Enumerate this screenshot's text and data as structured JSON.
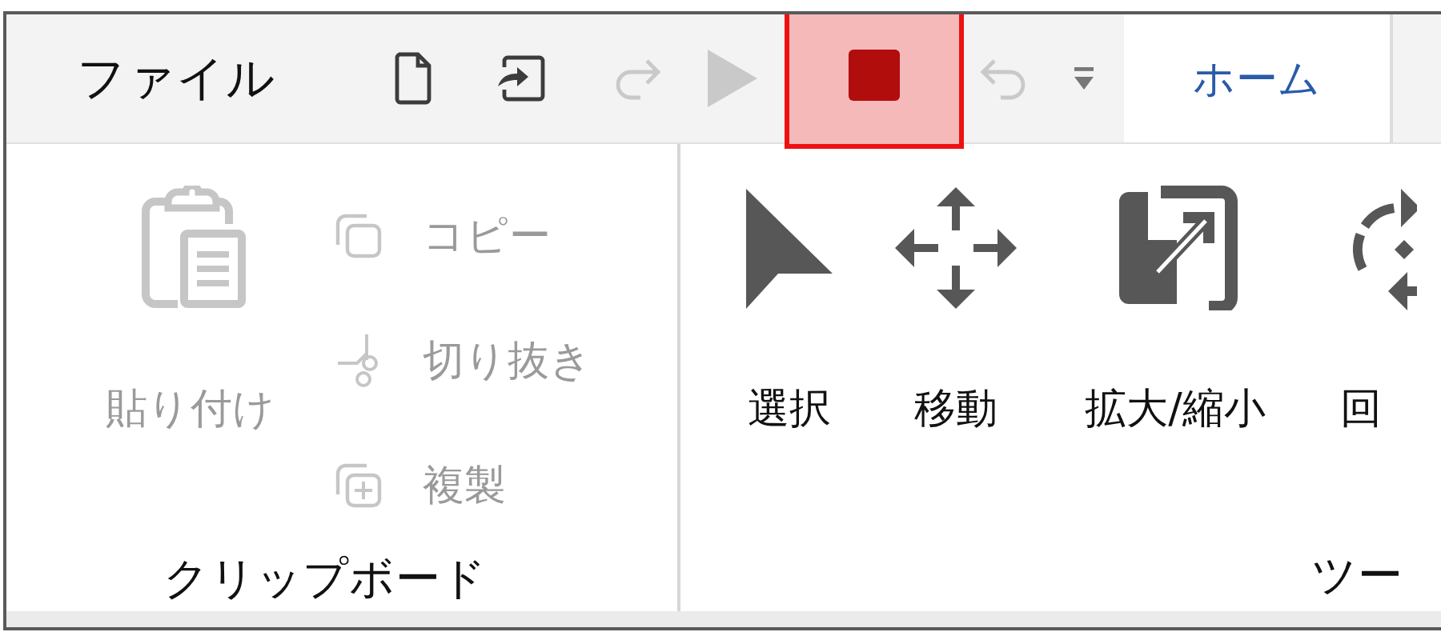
{
  "menu": {
    "label": "ファイル"
  },
  "quick_access": [
    {
      "kind": "new-file",
      "disabled": false,
      "highlighted": false
    },
    {
      "kind": "import",
      "disabled": false,
      "highlighted": false
    },
    {
      "kind": "redo",
      "disabled": true,
      "highlighted": false
    },
    {
      "kind": "play",
      "disabled": true,
      "highlighted": false
    },
    {
      "kind": "stop",
      "disabled": false,
      "highlighted": true
    },
    {
      "kind": "undo",
      "disabled": true,
      "highlighted": false
    },
    {
      "kind": "customize",
      "disabled": false,
      "highlighted": false
    }
  ],
  "tabs": [
    {
      "label": "ホーム",
      "selected": true
    }
  ],
  "groups": [
    {
      "title": "クリップボード",
      "large_items": [
        {
          "label": "貼り付け",
          "kind": "paste",
          "disabled": true
        }
      ],
      "small_items": [
        {
          "label": "コピー",
          "kind": "copy",
          "disabled": true
        },
        {
          "label": "切り抜き",
          "kind": "cut",
          "disabled": true
        },
        {
          "label": "複製",
          "kind": "duplicate",
          "disabled": true
        }
      ]
    },
    {
      "title": "ツー",
      "large_items": [
        {
          "label": "選択",
          "kind": "select",
          "disabled": false
        },
        {
          "label": "移動",
          "kind": "move",
          "disabled": false
        },
        {
          "label": "拡大/縮小",
          "kind": "scale",
          "disabled": false
        },
        {
          "label": "回",
          "kind": "rotate",
          "disabled": false
        }
      ]
    }
  ]
}
